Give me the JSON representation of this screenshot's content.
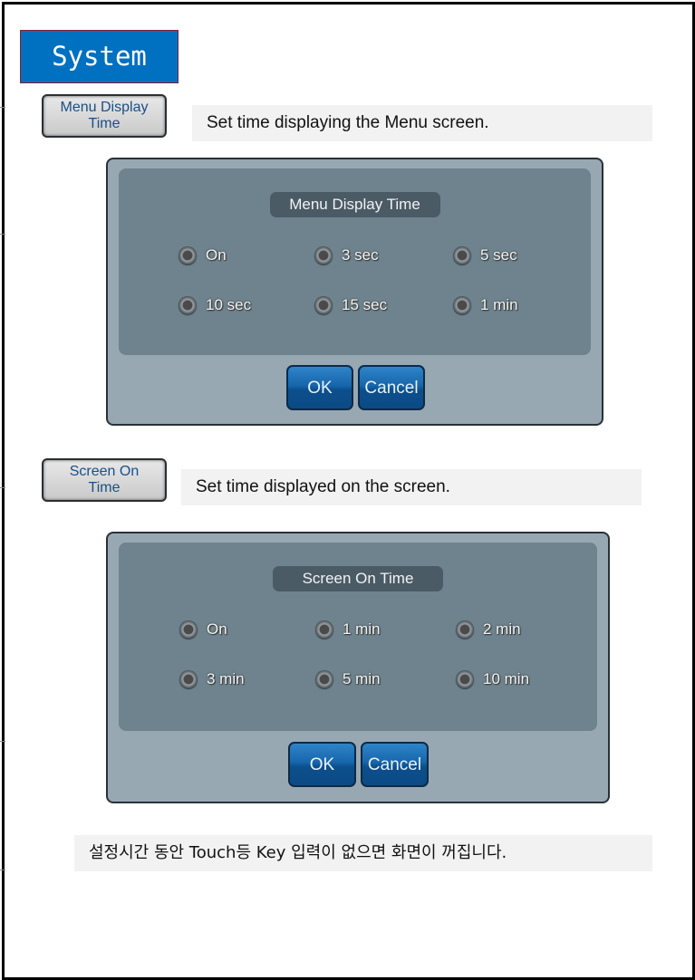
{
  "section_title": "System",
  "menu_display": {
    "chip_line1": "Menu Display",
    "chip_line2": "Time",
    "description": "Set time displaying the Menu screen.",
    "dialog": {
      "title": "Menu Display Time",
      "options": [
        "On",
        "3 sec",
        "5 sec",
        "10 sec",
        "15 sec",
        "1 min"
      ],
      "ok_label": "OK",
      "cancel_label": "Cancel"
    }
  },
  "screen_on": {
    "chip_line1": "Screen On",
    "chip_line2": "Time",
    "description": "Set time displayed on the screen.",
    "dialog": {
      "title": "Screen On Time",
      "options": [
        "On",
        "1 min",
        "2 min",
        "3 min",
        "5 min",
        "10 min"
      ],
      "ok_label": "OK",
      "cancel_label": "Cancel"
    }
  },
  "note": "설정시간 동안 Touch등 Key 입력이 없으면 화면이 꺼집니다."
}
